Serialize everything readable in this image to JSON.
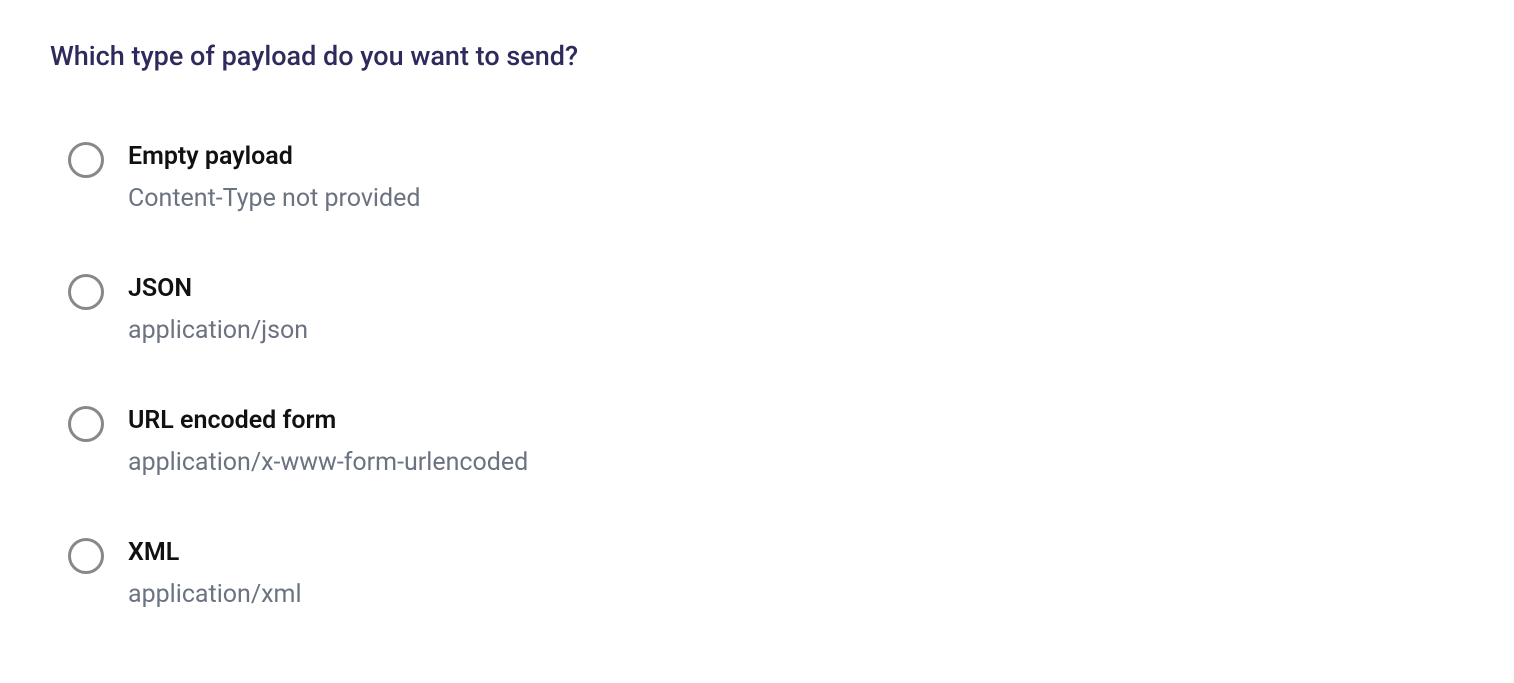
{
  "heading": "Which type of payload do you want to send?",
  "options": [
    {
      "title": "Empty payload",
      "subtitle": "Content-Type not provided"
    },
    {
      "title": "JSON",
      "subtitle": "application/json"
    },
    {
      "title": "URL encoded form",
      "subtitle": "application/x-www-form-urlencoded"
    },
    {
      "title": "XML",
      "subtitle": "application/xml"
    }
  ]
}
